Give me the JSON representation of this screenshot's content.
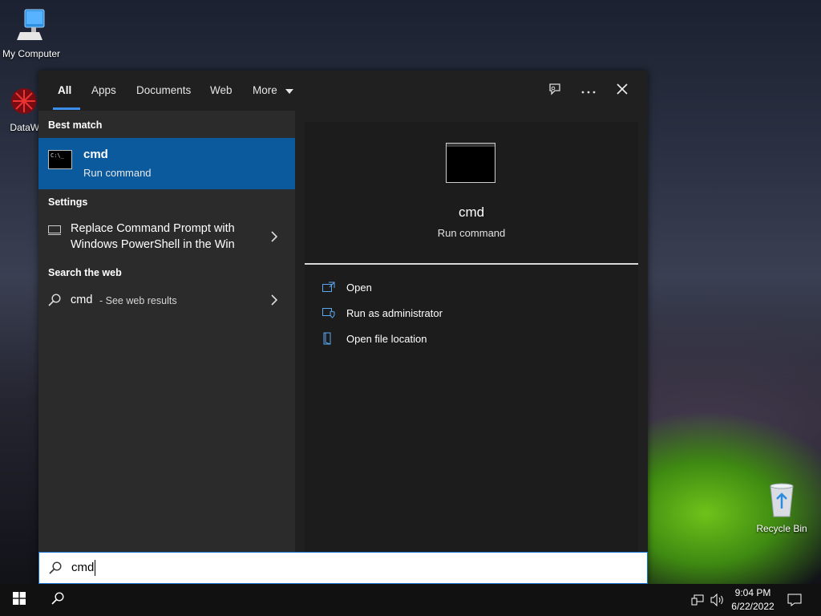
{
  "desktop": {
    "icons": [
      {
        "label": "My Computer"
      },
      {
        "label": "DataWag"
      },
      {
        "label": "Recycle Bin"
      }
    ]
  },
  "search": {
    "tabs": [
      {
        "label": "All"
      },
      {
        "label": "Apps"
      },
      {
        "label": "Documents"
      },
      {
        "label": "Web"
      },
      {
        "label": "More"
      }
    ],
    "sections": {
      "best_match": "Best match",
      "settings": "Settings",
      "search_web": "Search the web"
    },
    "best_match": {
      "title": "cmd",
      "subtitle": "Run command",
      "icon_text": "C:\\_"
    },
    "settings_item": {
      "line1": "Replace Command Prompt with",
      "line2": "Windows PowerShell in the Win"
    },
    "web_item": {
      "query": "cmd",
      "suffix": "- See web results"
    },
    "preview": {
      "title": "cmd",
      "subtitle": "Run command",
      "actions": [
        {
          "label": "Open"
        },
        {
          "label": "Run as administrator"
        },
        {
          "label": "Open file location"
        }
      ]
    },
    "input": {
      "value": "cmd"
    }
  },
  "taskbar": {
    "time": "9:04 PM",
    "date": "6/22/2022"
  },
  "colors": {
    "accent": "#0b5a9e",
    "tab_underline": "#3b8eea"
  }
}
